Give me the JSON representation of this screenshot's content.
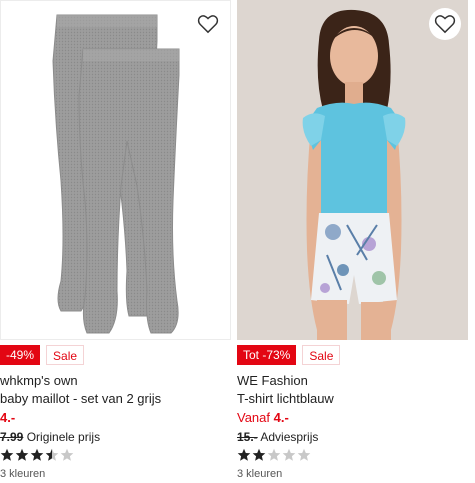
{
  "products": [
    {
      "discount": "-49%",
      "sale": "Sale",
      "brand": "whkmp's own",
      "name": "baby maillot - set van 2 grijs",
      "price_prefix": "",
      "price": "4.-",
      "old_price": "7.99",
      "old_price_label": "Originele prijs",
      "rating": 3.5,
      "colors": "3 kleuren",
      "favorite_icon": "heart-outline-icon",
      "image": "grey-tights-product-photo"
    },
    {
      "discount": "Tot -73%",
      "sale": "Sale",
      "brand": "WE Fashion",
      "name": "T-shirt lichtblauw",
      "price_prefix": "Vanaf",
      "price": "4.-",
      "old_price": "15.-",
      "old_price_label": "Adviesprijs",
      "rating": 2,
      "colors": "3 kleuren",
      "favorite_icon": "heart-outline-icon",
      "image": "girl-in-blue-top-photo"
    }
  ],
  "colors": {
    "sale_red": "#e30613",
    "star_filled": "#222222",
    "star_empty": "#c8c8c8"
  }
}
